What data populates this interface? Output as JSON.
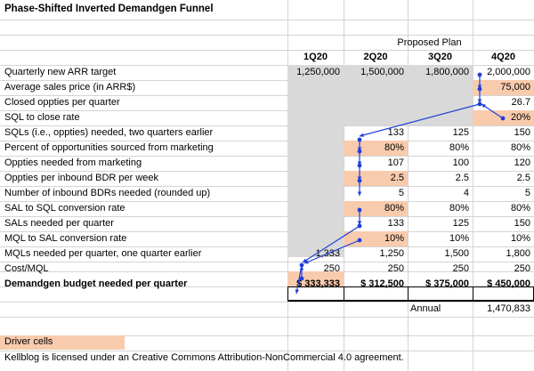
{
  "title": "Phase-Shifted Inverted Demandgen Funnel",
  "plan_label": "Proposed Plan",
  "quarters": [
    "1Q20",
    "2Q20",
    "3Q20",
    "4Q20"
  ],
  "rows": [
    {
      "label": "Quarterly new ARR target",
      "values": [
        "1,250,000",
        "1,500,000",
        "1,800,000",
        "2,000,000"
      ]
    },
    {
      "label": "Average sales price (in ARR$)",
      "values": [
        "",
        "",
        "",
        "75,000"
      ]
    },
    {
      "label": "Closed oppties per quarter",
      "values": [
        "",
        "",
        "",
        "26.7"
      ]
    },
    {
      "label": "SQL to close rate",
      "values": [
        "",
        "",
        "",
        "20%"
      ]
    },
    {
      "label": "SQLs (i.e., oppties) needed, two quarters earlier",
      "values": [
        "",
        "133",
        "125",
        "150"
      ]
    },
    {
      "label": "Percent of opportunities sourced from marketing",
      "values": [
        "",
        "80%",
        "80%",
        "80%"
      ]
    },
    {
      "label": "Oppties needed from marketing",
      "values": [
        "",
        "107",
        "100",
        "120"
      ]
    },
    {
      "label": "Oppties per inbound BDR per week",
      "values": [
        "",
        "2.5",
        "2.5",
        "2.5"
      ]
    },
    {
      "label": "Number of inbound BDRs needed (rounded up)",
      "values": [
        "",
        "5",
        "4",
        "5"
      ]
    },
    {
      "label": "SAL to SQL conversion rate",
      "values": [
        "",
        "80%",
        "80%",
        "80%"
      ]
    },
    {
      "label": "SALs needed per quarter",
      "values": [
        "",
        "133",
        "125",
        "150"
      ]
    },
    {
      "label": "MQL to SAL conversion rate",
      "values": [
        "",
        "10%",
        "10%",
        "10%"
      ]
    },
    {
      "label": "MQLs needed per quarter, one quarter earlier",
      "values": [
        "1,333",
        "1,250",
        "1,500",
        "1,800"
      ]
    },
    {
      "label": "Cost/MQL",
      "values": [
        "250",
        "250",
        "250",
        "250"
      ]
    },
    {
      "label": "Demandgen budget needed per quarter",
      "values": [
        "$ 333,333",
        "$ 312,500",
        "$ 375,000",
        "$ 450,000"
      ]
    }
  ],
  "annual_label": "Annual",
  "annual_value": "1,470,833",
  "driver_label": "Driver cells",
  "footer": "Kellblog is licensed under an Creative Commons Attribution-NonCommercial 4.0  agreement.",
  "colors": {
    "driver": "#f8cbad",
    "gray": "#d9d9d9",
    "arrow": "#1f3fd8",
    "grid": "#d4d4d4"
  }
}
